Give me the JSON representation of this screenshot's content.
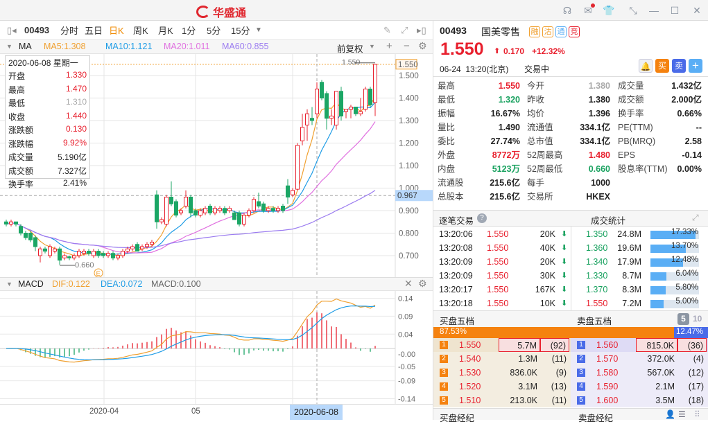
{
  "app": {
    "title": "华盛通"
  },
  "window_icons": [
    "headset-icon",
    "mail-icon",
    "shirt-icon",
    "shrink-icon",
    "minimize-icon",
    "maximize-icon",
    "close-icon"
  ],
  "toolbar": {
    "code": "00493",
    "periods": [
      "分时",
      "五日",
      "日K",
      "周K",
      "月K",
      "1分",
      "5分",
      "15分"
    ],
    "active_period": "日K"
  },
  "ma_row": {
    "label": "MA",
    "ma5": "MA5:1.308",
    "ma10": "MA10:1.121",
    "ma20": "MA20:1.011",
    "ma60": "MA60:0.855",
    "adjust": "前复权"
  },
  "info_box": {
    "date": "2020-06-08 星期一",
    "rows": [
      {
        "label": "开盘",
        "value": "1.330",
        "color": "#e8202e"
      },
      {
        "label": "最高",
        "value": "1.470",
        "color": "#e8202e"
      },
      {
        "label": "最低",
        "value": "1.310",
        "color": "#aaaaaa"
      },
      {
        "label": "收盘",
        "value": "1.440",
        "color": "#e8202e"
      },
      {
        "label": "涨跌额",
        "value": "0.130",
        "color": "#e8202e"
      },
      {
        "label": "涨跌幅",
        "value": "9.92%",
        "color": "#e8202e"
      },
      {
        "label": "成交量",
        "value": "5.190亿",
        "color": "#222222"
      },
      {
        "label": "成交额",
        "value": "7.327亿",
        "color": "#222222"
      },
      {
        "label": "换手率",
        "value": "2.41%",
        "color": "#222222"
      }
    ]
  },
  "chart_data": {
    "type": "candlestick",
    "price_axis": [
      "1.500",
      "1.400",
      "1.300",
      "1.200",
      "1.100",
      "1.000",
      "0.900",
      "0.800",
      "0.700"
    ],
    "last_price_label": "1.550",
    "crosshair_price_label": "0.967",
    "high_marker": "1.550",
    "low_marker": "0.660",
    "event_marker": "E",
    "ylim": [
      0.7,
      1.5
    ],
    "crosshair_index": 64,
    "ohlc": [
      [
        0.85,
        0.86,
        0.83,
        0.84
      ],
      [
        0.84,
        0.86,
        0.83,
        0.85
      ],
      [
        0.85,
        0.85,
        0.83,
        0.84
      ],
      [
        0.83,
        0.84,
        0.79,
        0.8
      ],
      [
        0.8,
        0.81,
        0.77,
        0.78
      ],
      [
        0.8,
        0.81,
        0.76,
        0.77
      ],
      [
        0.78,
        0.79,
        0.72,
        0.74
      ],
      [
        0.7,
        0.74,
        0.67,
        0.73
      ],
      [
        0.73,
        0.74,
        0.71,
        0.72
      ],
      [
        0.7,
        0.75,
        0.69,
        0.74
      ],
      [
        0.72,
        0.74,
        0.71,
        0.73
      ],
      [
        0.73,
        0.74,
        0.66,
        0.68
      ],
      [
        0.69,
        0.71,
        0.68,
        0.7
      ],
      [
        0.695,
        0.7,
        0.68,
        0.69
      ],
      [
        0.69,
        0.71,
        0.68,
        0.7
      ],
      [
        0.7,
        0.73,
        0.69,
        0.72
      ],
      [
        0.71,
        0.73,
        0.7,
        0.72
      ],
      [
        0.72,
        0.73,
        0.7,
        0.71
      ],
      [
        0.7,
        0.73,
        0.69,
        0.72
      ],
      [
        0.72,
        0.73,
        0.69,
        0.7
      ],
      [
        0.71,
        0.72,
        0.69,
        0.7
      ],
      [
        0.7,
        0.72,
        0.69,
        0.71
      ],
      [
        0.71,
        0.72,
        0.68,
        0.69
      ],
      [
        0.69,
        0.71,
        0.68,
        0.7
      ],
      [
        0.7,
        0.73,
        0.69,
        0.72
      ],
      [
        0.72,
        0.74,
        0.71,
        0.73
      ],
      [
        0.73,
        0.75,
        0.72,
        0.74
      ],
      [
        0.75,
        0.76,
        0.72,
        0.72
      ],
      [
        0.73,
        0.75,
        0.72,
        0.74
      ],
      [
        0.74,
        0.76,
        0.73,
        0.75
      ],
      [
        0.75,
        0.77,
        0.74,
        0.76
      ],
      [
        0.97,
        0.99,
        0.82,
        0.85
      ],
      [
        0.85,
        0.87,
        0.84,
        0.86
      ],
      [
        0.84,
        0.97,
        0.83,
        0.96
      ],
      [
        0.96,
        1.03,
        0.92,
        0.93
      ],
      [
        0.94,
        0.95,
        0.87,
        0.88
      ],
      [
        0.89,
        0.91,
        0.88,
        0.9
      ],
      [
        0.92,
        0.99,
        0.91,
        0.96
      ],
      [
        0.96,
        0.97,
        0.87,
        0.89
      ],
      [
        0.9,
        0.91,
        0.87,
        0.88
      ],
      [
        0.88,
        0.91,
        0.87,
        0.9
      ],
      [
        0.89,
        0.92,
        0.88,
        0.91
      ],
      [
        0.92,
        0.93,
        0.88,
        0.89
      ],
      [
        0.89,
        0.92,
        0.88,
        0.91
      ],
      [
        0.9,
        0.92,
        0.89,
        0.91
      ],
      [
        0.91,
        0.92,
        0.88,
        0.89
      ],
      [
        0.9,
        0.92,
        0.89,
        0.91
      ],
      [
        0.89,
        0.9,
        0.86,
        0.86
      ],
      [
        0.89,
        0.9,
        0.83,
        0.84
      ],
      [
        0.84,
        0.89,
        0.83,
        0.88
      ],
      [
        0.88,
        0.91,
        0.87,
        0.9
      ],
      [
        0.9,
        0.96,
        0.89,
        0.95
      ],
      [
        0.94,
        0.98,
        0.91,
        0.92
      ],
      [
        0.93,
        0.94,
        0.89,
        0.9
      ],
      [
        0.9,
        0.92,
        0.89,
        0.91
      ],
      [
        0.91,
        0.92,
        0.89,
        0.9
      ],
      [
        0.9,
        0.92,
        0.89,
        0.91
      ],
      [
        0.92,
        0.93,
        0.89,
        0.9
      ],
      [
        1.01,
        1.04,
        0.93,
        0.96
      ],
      [
        0.97,
        1.0,
        0.96,
        0.99
      ],
      [
        0.995,
        1.2,
        0.99,
        1.19
      ],
      [
        1.21,
        1.33,
        1.19,
        1.27
      ],
      [
        1.28,
        1.35,
        1.21,
        1.33
      ],
      [
        1.31,
        1.36,
        1.28,
        1.3
      ],
      [
        1.33,
        1.47,
        1.31,
        1.44
      ],
      [
        1.47,
        1.48,
        1.39,
        1.4
      ],
      [
        1.42,
        1.43,
        1.26,
        1.31
      ],
      [
        1.31,
        1.35,
        1.28,
        1.32
      ],
      [
        1.28,
        1.43,
        1.26,
        1.43
      ],
      [
        1.43,
        1.45,
        1.3,
        1.32
      ],
      [
        1.34,
        1.35,
        1.31,
        1.35
      ],
      [
        1.35,
        1.37,
        1.31,
        1.36
      ],
      [
        1.36,
        1.36,
        1.32,
        1.33
      ],
      [
        1.33,
        1.4,
        1.32,
        1.34
      ],
      [
        1.35,
        1.45,
        1.34,
        1.44
      ],
      [
        1.44,
        1.45,
        1.36,
        1.37
      ],
      [
        1.38,
        1.55,
        1.32,
        1.55
      ]
    ],
    "ma_periods": [
      5,
      10,
      20,
      60
    ],
    "ma_colors": [
      "#f0a030",
      "#1e9ce6",
      "#e070e0",
      "#9b7cf0"
    ],
    "macd": {
      "label": "MACD",
      "dif": "DIF:0.122",
      "dea": "DEA:0.072",
      "macd": "MACD:0.100",
      "axis": [
        "0.14",
        "0.09",
        "0.04",
        "-0.00",
        "-0.05",
        "-0.09",
        "-0.14"
      ],
      "ylim": [
        -0.14,
        0.14
      ]
    },
    "x_labels": [
      "2020-04",
      "05",
      "2020-06-08"
    ]
  },
  "quote": {
    "code": "00493",
    "name": "国美零售",
    "badges": [
      {
        "t": "融",
        "c": "#f0a030"
      },
      {
        "t": "沽",
        "c": "#f0a030"
      },
      {
        "t": "通",
        "c": "#5aaef5"
      },
      {
        "t": "竞",
        "c": "#e8202e"
      }
    ],
    "price": "1.550",
    "change": "0.170",
    "change_pct": "+12.32%",
    "time": "06-24  13:20(北京)",
    "status": "交易中",
    "buy": "买",
    "sell": "卖",
    "stats": [
      [
        {
          "l": "最高",
          "v": "1.550",
          "c": "#e8202e"
        },
        {
          "l": "今开",
          "v": "1.380",
          "c": "#aaaaaa"
        },
        {
          "l": "成交量",
          "v": "1.432亿",
          "c": "#222"
        }
      ],
      [
        {
          "l": "最低",
          "v": "1.320",
          "c": "#1aa260"
        },
        {
          "l": "昨收",
          "v": "1.380",
          "c": "#222"
        },
        {
          "l": "成交额",
          "v": "2.000亿",
          "c": "#222"
        }
      ],
      [
        {
          "l": "振幅",
          "v": "16.67%",
          "c": "#222"
        },
        {
          "l": "均价",
          "v": "1.396",
          "c": "#222"
        },
        {
          "l": "换手率",
          "v": "0.66%",
          "c": "#222"
        }
      ],
      [
        {
          "l": "量比",
          "v": "1.490",
          "c": "#222"
        },
        {
          "l": "流通值",
          "v": "334.1亿",
          "c": "#222"
        },
        {
          "l": "PE(TTM)",
          "v": "--",
          "c": "#222"
        }
      ],
      [
        {
          "l": "委比",
          "v": "27.74%",
          "c": "#222"
        },
        {
          "l": "总市值",
          "v": "334.1亿",
          "c": "#222"
        },
        {
          "l": "PB(MRQ)",
          "v": "2.58",
          "c": "#222"
        }
      ],
      [
        {
          "l": "外盘",
          "v": "8772万",
          "c": "#e8202e"
        },
        {
          "l": "52周最高",
          "v": "1.480",
          "c": "#e8202e"
        },
        {
          "l": "EPS",
          "v": "-0.14",
          "c": "#222"
        }
      ],
      [
        {
          "l": "内盘",
          "v": "5123万",
          "c": "#1aa260"
        },
        {
          "l": "52周最低",
          "v": "0.660",
          "c": "#1aa260"
        },
        {
          "l": "股息率(TTM)",
          "v": "0.00%",
          "c": "#222"
        }
      ],
      [
        {
          "l": "流通股",
          "v": "215.6亿",
          "c": "#222"
        },
        {
          "l": "每手",
          "v": "1000",
          "c": "#222"
        },
        null
      ],
      [
        {
          "l": "总股本",
          "v": "215.6亿",
          "c": "#222"
        },
        {
          "l": "交易所",
          "v": "HKEX",
          "c": "#222"
        },
        null
      ]
    ]
  },
  "trades": {
    "title": "逐笔交易",
    "stats_title": "成交统计",
    "ticks": [
      [
        "13:20:06",
        "1.550",
        "20K"
      ],
      [
        "13:20:08",
        "1.550",
        "40K"
      ],
      [
        "13:20:09",
        "1.550",
        "20K"
      ],
      [
        "13:20:09",
        "1.550",
        "30K"
      ],
      [
        "13:20:17",
        "1.550",
        "167K"
      ],
      [
        "13:20:18",
        "1.550",
        "10K"
      ]
    ],
    "stats": [
      {
        "p": "1.350",
        "v": "24.8M",
        "pct": "17.33%",
        "n": 17.33,
        "c": "#1aa260"
      },
      {
        "p": "1.360",
        "v": "19.6M",
        "pct": "13.70%",
        "n": 13.7,
        "c": "#1aa260"
      },
      {
        "p": "1.340",
        "v": "17.9M",
        "pct": "12.48%",
        "n": 12.48,
        "c": "#1aa260"
      },
      {
        "p": "1.330",
        "v": "8.7M",
        "pct": "6.04%",
        "n": 6.04,
        "c": "#1aa260"
      },
      {
        "p": "1.370",
        "v": "8.3M",
        "pct": "5.80%",
        "n": 5.8,
        "c": "#1aa260"
      },
      {
        "p": "1.550",
        "v": "7.2M",
        "pct": "5.00%",
        "n": 5.0,
        "c": "#e8202e"
      }
    ]
  },
  "orderbook": {
    "bid_title": "买盘五档",
    "ask_title": "卖盘五档",
    "depth5": "5",
    "depth10": "10",
    "bid_ratio": "87.53%",
    "ask_ratio": "12.47%",
    "bid_fraction": 0.8753,
    "bids": [
      [
        "1",
        "1.550",
        "5.7M",
        "(92)"
      ],
      [
        "2",
        "1.540",
        "1.3M",
        "(11)"
      ],
      [
        "3",
        "1.530",
        "836.0K",
        "(9)"
      ],
      [
        "4",
        "1.520",
        "3.1M",
        "(13)"
      ],
      [
        "5",
        "1.510",
        "213.0K",
        "(11)"
      ]
    ],
    "asks": [
      [
        "1",
        "1.560",
        "815.0K",
        "(36)"
      ],
      [
        "2",
        "1.570",
        "372.0K",
        "(4)"
      ],
      [
        "3",
        "1.580",
        "567.0K",
        "(12)"
      ],
      [
        "4",
        "1.590",
        "2.1M",
        "(17)"
      ],
      [
        "5",
        "1.600",
        "3.5M",
        "(18)"
      ]
    ],
    "bid_broker": "买盘经纪",
    "ask_broker": "卖盘经纪"
  }
}
